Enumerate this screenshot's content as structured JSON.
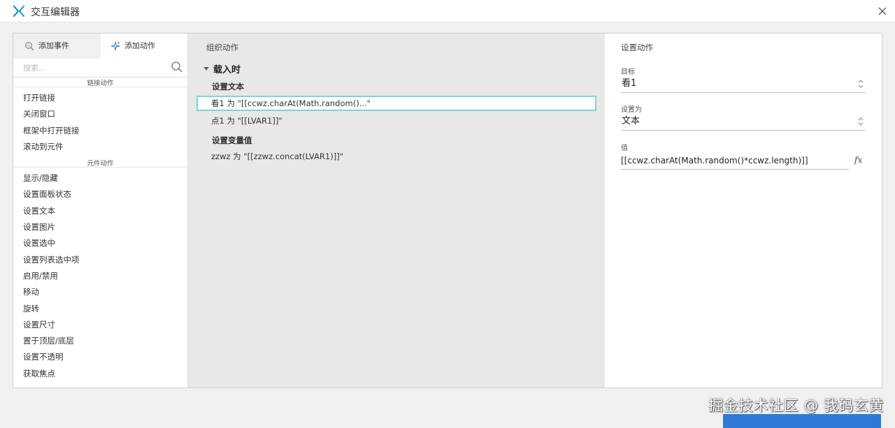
{
  "window": {
    "title": "交互编辑器"
  },
  "tabs": [
    {
      "label": "添加事件",
      "icon": "event-icon",
      "active": false
    },
    {
      "label": "添加动作",
      "icon": "sparkle-icon",
      "active": true
    }
  ],
  "search": {
    "placeholder": "搜索..."
  },
  "groups": [
    {
      "title": "链接动作",
      "items": [
        "打开链接",
        "关闭窗口",
        "框架中打开链接",
        "滚动到元件"
      ]
    },
    {
      "title": "元件动作",
      "items": [
        "显示/隐藏",
        "设置面板状态",
        "设置文本",
        "设置图片",
        "设置选中",
        "设置列表选中项",
        "启用/禁用",
        "移动",
        "旋转",
        "设置尺寸",
        "置于顶层/底层",
        "设置不透明",
        "获取焦点"
      ]
    }
  ],
  "organize": {
    "title": "组织动作",
    "event": "载入时",
    "categories": [
      {
        "name": "设置文本",
        "actions": [
          "看1 为 \"[[ccwz.charAt(Math.random()...\"",
          "点1 为 \"[[LVAR1]]\""
        ]
      },
      {
        "name": "设置变量值",
        "actions": [
          "zzwz 为 \"[[zzwz.concat(LVAR1)]]\""
        ]
      }
    ]
  },
  "config": {
    "title": "设置动作",
    "target_label": "目标",
    "target_value": "看1",
    "setas_label": "设置为",
    "setas_value": "文本",
    "value_label": "值",
    "value": "[[ccwz.charAt(Math.random()*ccwz.length)]]",
    "fx_label": "fx"
  },
  "watermark": "掘金技术社区 @ 我码玄黄",
  "colors": {
    "accent": "#75d6d6",
    "logo": "#1e88e5",
    "panel_bg": "#e8e8e8"
  }
}
